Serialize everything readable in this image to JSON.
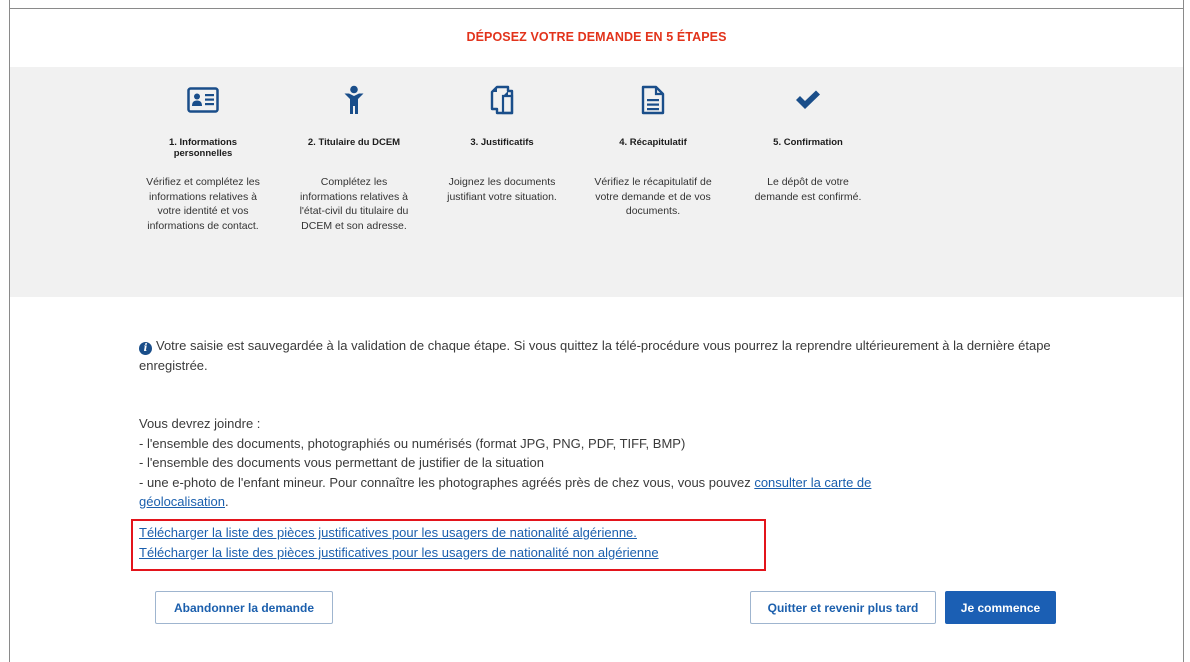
{
  "header": {
    "title": "DÉPOSEZ VOTRE DEMANDE EN 5 ÉTAPES"
  },
  "steps": [
    {
      "icon": "id-card-icon",
      "label": "1. Informations personnelles",
      "description": "Vérifiez et complétez les informations relatives à votre identité et vos informations de contact."
    },
    {
      "icon": "child-person-icon",
      "label": "2. Titulaire du DCEM",
      "description": "Complétez les informations relatives à l'état-civil du titulaire du DCEM et son adresse."
    },
    {
      "icon": "documents-icon",
      "label": "3. Justificatifs",
      "description": "Joignez les documents justifiant votre situation."
    },
    {
      "icon": "file-text-icon",
      "label": "4. Récapitulatif",
      "description": "Vérifiez le récapitulatif de votre demande et de vos documents."
    },
    {
      "icon": "checkmark-icon",
      "label": "5. Confirmation",
      "description": "Le dépôt de votre demande est confirmé."
    }
  ],
  "info": {
    "text": "Votre saisie est sauvegardée à la validation de chaque étape. Si vous quittez la télé-procédure vous pourrez la reprendre ultérieurement à la dernière étape enregistrée."
  },
  "requirements": {
    "intro": "Vous devrez joindre :",
    "item1": "- l'ensemble des documents, photographiés ou numérisés (format JPG, PNG, PDF, TIFF, BMP)",
    "item2": "- l'ensemble des documents vous permettant de justifier de la situation",
    "item3_prefix": "- une e-photo de l'enfant mineur. Pour connaître les photographes agréés près de chez vous, vous pouvez ",
    "item3_link_part1": "consulter la carte de",
    "item3_link_part2": "géolocalisation",
    "item3_suffix": "."
  },
  "downloads": {
    "algerian": "Télécharger la liste des pièces justificatives pour les usagers de nationalité algérienne.",
    "non_algerian": "Télécharger la liste des pièces justificatives pour les usagers de nationalité non algérienne"
  },
  "buttons": {
    "abandon": "Abandonner la demande",
    "quit_later": "Quitter et revenir plus tard",
    "start": "Je commence"
  },
  "colors": {
    "title_red": "#e2331b",
    "icon_blue": "#1a4e8a",
    "link_blue": "#1b5fad",
    "primary_button": "#1b5fb4",
    "highlight_red": "#e3141b",
    "band_gray": "#f1f1f1"
  }
}
